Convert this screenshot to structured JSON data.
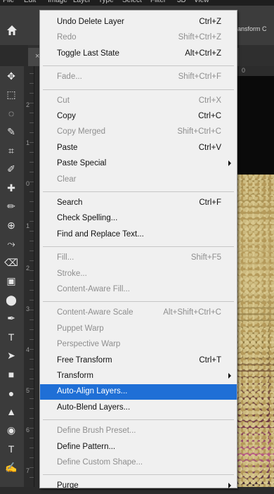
{
  "menubar": {
    "items": [
      "File",
      "Edit",
      "Image",
      "Layer",
      "Type",
      "Select",
      "Filter",
      "3D",
      "View"
    ]
  },
  "optionsbar": {
    "home_icon": "home-icon",
    "right_text": "ransform C"
  },
  "tab": {
    "close_glyph": "×"
  },
  "toolbar": {
    "tools": [
      {
        "icon": "move-icon",
        "glyph": "✥"
      },
      {
        "icon": "marquee-icon",
        "glyph": "⬚"
      },
      {
        "icon": "lasso-icon",
        "glyph": "◌"
      },
      {
        "icon": "quick-select-icon",
        "glyph": "✎"
      },
      {
        "icon": "crop-icon",
        "glyph": "⌗"
      },
      {
        "icon": "eyedropper-icon",
        "glyph": "✐"
      },
      {
        "icon": "healing-brush-icon",
        "glyph": "✚"
      },
      {
        "icon": "brush-icon",
        "glyph": "✏"
      },
      {
        "icon": "clone-stamp-icon",
        "glyph": "⊕"
      },
      {
        "icon": "history-brush-icon",
        "glyph": "⤳"
      },
      {
        "icon": "eraser-icon",
        "glyph": "⌫"
      },
      {
        "icon": "gradient-icon",
        "glyph": "▣"
      },
      {
        "icon": "dodge-icon",
        "glyph": "⬤"
      },
      {
        "icon": "pen-icon",
        "glyph": "✒"
      },
      {
        "icon": "type-icon",
        "glyph": "T"
      },
      {
        "icon": "path-select-icon",
        "glyph": "➤"
      },
      {
        "icon": "shape-icon",
        "glyph": "■"
      },
      {
        "icon": "drop-icon",
        "glyph": "●"
      },
      {
        "icon": "triangle-icon",
        "glyph": "▲"
      },
      {
        "icon": "zoom-icon",
        "glyph": "◉"
      },
      {
        "icon": "text-icon",
        "glyph": "T"
      },
      {
        "icon": "paint-icon",
        "glyph": "✍"
      }
    ]
  },
  "ruler": {
    "vertical_numbers": [
      "2",
      "1",
      "0",
      "1",
      "2",
      "3",
      "4",
      "5",
      "6",
      "7"
    ],
    "horizontal_numbers": [
      "0"
    ]
  },
  "menu": {
    "items": [
      {
        "label": "Undo Delete Layer",
        "shortcut": "Ctrl+Z",
        "state": "enabled"
      },
      {
        "label": "Redo",
        "shortcut": "Shift+Ctrl+Z",
        "state": "disabled"
      },
      {
        "label": "Toggle Last State",
        "shortcut": "Alt+Ctrl+Z",
        "state": "enabled"
      },
      {
        "sep": true
      },
      {
        "label": "Fade...",
        "shortcut": "Shift+Ctrl+F",
        "state": "disabled"
      },
      {
        "sep": true
      },
      {
        "label": "Cut",
        "shortcut": "Ctrl+X",
        "state": "disabled"
      },
      {
        "label": "Copy",
        "shortcut": "Ctrl+C",
        "state": "enabled"
      },
      {
        "label": "Copy Merged",
        "shortcut": "Shift+Ctrl+C",
        "state": "disabled"
      },
      {
        "label": "Paste",
        "shortcut": "Ctrl+V",
        "state": "enabled"
      },
      {
        "label": "Paste Special",
        "shortcut": "",
        "state": "enabled",
        "submenu": true
      },
      {
        "label": "Clear",
        "shortcut": "",
        "state": "disabled"
      },
      {
        "sep": true
      },
      {
        "label": "Search",
        "shortcut": "Ctrl+F",
        "state": "enabled"
      },
      {
        "label": "Check Spelling...",
        "shortcut": "",
        "state": "enabled"
      },
      {
        "label": "Find and Replace Text...",
        "shortcut": "",
        "state": "enabled"
      },
      {
        "sep": true
      },
      {
        "label": "Fill...",
        "shortcut": "Shift+F5",
        "state": "disabled"
      },
      {
        "label": "Stroke...",
        "shortcut": "",
        "state": "disabled"
      },
      {
        "label": "Content-Aware Fill...",
        "shortcut": "",
        "state": "disabled"
      },
      {
        "sep": true
      },
      {
        "label": "Content-Aware Scale",
        "shortcut": "Alt+Shift+Ctrl+C",
        "state": "disabled"
      },
      {
        "label": "Puppet Warp",
        "shortcut": "",
        "state": "disabled"
      },
      {
        "label": "Perspective Warp",
        "shortcut": "",
        "state": "disabled"
      },
      {
        "label": "Free Transform",
        "shortcut": "Ctrl+T",
        "state": "enabled"
      },
      {
        "label": "Transform",
        "shortcut": "",
        "state": "enabled",
        "submenu": true
      },
      {
        "label": "Auto-Align Layers...",
        "shortcut": "",
        "state": "highlighted"
      },
      {
        "label": "Auto-Blend Layers...",
        "shortcut": "",
        "state": "enabled"
      },
      {
        "sep": true
      },
      {
        "label": "Define Brush Preset...",
        "shortcut": "",
        "state": "disabled"
      },
      {
        "label": "Define Pattern...",
        "shortcut": "",
        "state": "enabled"
      },
      {
        "label": "Define Custom Shape...",
        "shortcut": "",
        "state": "disabled"
      },
      {
        "sep": true
      },
      {
        "label": "Purge",
        "shortcut": "",
        "state": "enabled",
        "submenu": true
      }
    ]
  },
  "colors": {
    "highlight": "#1f6fd6",
    "menu_bg": "#f0f0f0",
    "disabled_text": "#8e8e8e"
  }
}
